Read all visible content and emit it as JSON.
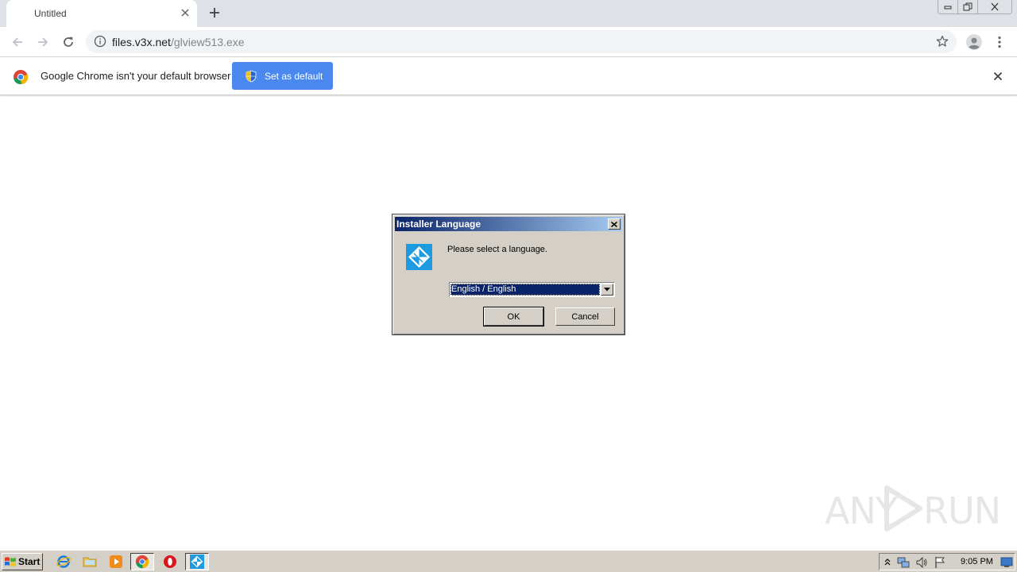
{
  "browser": {
    "tab": {
      "title": "Untitled"
    },
    "url": {
      "host": "files.v3x.net",
      "path": "/glview513.exe"
    }
  },
  "infobar": {
    "message": "Google Chrome isn't your default browser",
    "button_label": "Set as default"
  },
  "dialog": {
    "title": "Installer Language",
    "prompt": "Please select a language.",
    "selected_language": "English / English",
    "ok_label": "OK",
    "cancel_label": "Cancel"
  },
  "watermark": {
    "left": "ANY",
    "right": "RUN"
  },
  "taskbar": {
    "start_label": "Start",
    "clock": "9:05 PM"
  },
  "colors": {
    "infobar_button": "#4a88f0",
    "dialog_title_start": "#0a246a",
    "dialog_title_end": "#a6caf0",
    "dialog_face": "#d4d0c8"
  },
  "icons": {
    "tab_close": "close-icon",
    "new_tab": "plus-icon",
    "back": "arrow-left-icon",
    "forward": "arrow-right-icon",
    "reload": "reload-icon",
    "site_info": "info-icon",
    "bookmark": "star-icon",
    "profile": "person-icon",
    "menu": "three-dots-icon",
    "infobar_close": "close-icon"
  }
}
